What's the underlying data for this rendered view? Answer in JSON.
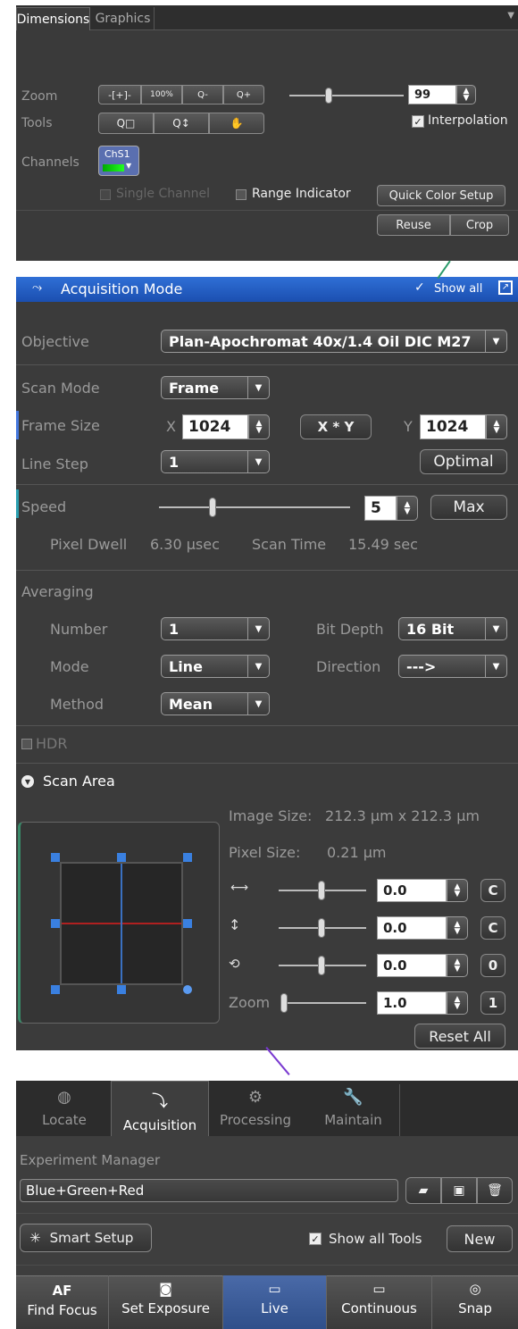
{
  "dimensions": {
    "tabs": [
      "Dimensions",
      "Graphics"
    ],
    "zoom_label": "Zoom",
    "zoom_buttons": [
      "-[+]-",
      "100%",
      "Q-",
      "Q+"
    ],
    "zoom_value": "99",
    "tools_label": "Tools",
    "interpolation_label": "Interpolation",
    "channels_label": "Channels",
    "channel_name": "ChS1",
    "single_channel_label": "Single Channel",
    "range_indicator_label": "Range Indicator",
    "quick_color_label": "Quick Color Setup",
    "reuse_label": "Reuse",
    "crop_label": "Crop"
  },
  "acquisition_mode": {
    "title": "Acquisition Mode",
    "show_all": "Show all",
    "objective_label": "Objective",
    "objective_value": "Plan-Apochromat 40x/1.4 Oil DIC M27",
    "scan_mode_label": "Scan Mode",
    "scan_mode_value": "Frame",
    "frame_size_label": "Frame Size",
    "x_label": "X",
    "x_value": "1024",
    "xy_button": "X * Y",
    "y_label": "Y",
    "y_value": "1024",
    "line_step_label": "Line Step",
    "line_step_value": "1",
    "optimal_button": "Optimal",
    "speed_label": "Speed",
    "speed_value": "5",
    "max_button": "Max",
    "pixel_dwell_label": "Pixel Dwell",
    "pixel_dwell_value": "6.30 µsec",
    "scan_time_label": "Scan Time",
    "scan_time_value": "15.49 sec",
    "averaging_label": "Averaging",
    "number_label": "Number",
    "number_value": "1",
    "bit_depth_label": "Bit Depth",
    "bit_depth_value": "16 Bit",
    "mode_label": "Mode",
    "mode_value": "Line",
    "direction_label": "Direction",
    "direction_value": "--->",
    "method_label": "Method",
    "method_value": "Mean",
    "hdr_label": "HDR",
    "scan_area_label": "Scan Area",
    "image_size_label": "Image Size:",
    "image_size_value": "212.3 µm x 212.3 µm",
    "pixel_size_label": "Pixel Size:",
    "pixel_size_value": "0.21 µm",
    "offset_x_value": "0.0",
    "offset_y_value": "0.0",
    "rotation_value": "0.0",
    "zoom_label": "Zoom",
    "zoom_value": "1.0",
    "c_button": "C",
    "zero_button": "0",
    "one_button": "1",
    "reset_all": "Reset All"
  },
  "tools": {
    "tabs": [
      "Locate",
      "Acquisition",
      "Processing",
      "Maintain"
    ],
    "experiment_manager_label": "Experiment Manager",
    "experiment_value": "Blue+Green+Red",
    "smart_setup": "Smart Setup",
    "show_all_tools": "Show all Tools",
    "new_button": "New",
    "actions": [
      {
        "top": "AF",
        "label": "Find Focus"
      },
      {
        "top": "",
        "label": "Set Exposure"
      },
      {
        "top": "",
        "label": "Live"
      },
      {
        "top": "",
        "label": "Continuous"
      },
      {
        "top": "",
        "label": "Snap"
      }
    ]
  }
}
